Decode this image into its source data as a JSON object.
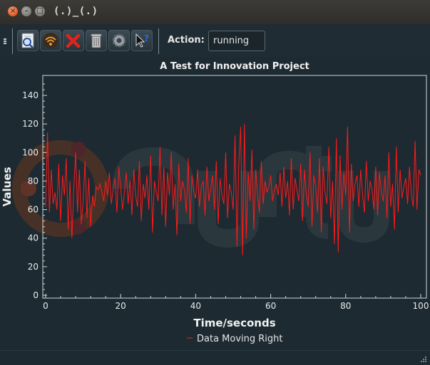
{
  "window": {
    "title": "(.)_(.)"
  },
  "toolbar": {
    "buttons": [
      {
        "icon": "zoom-document-icon"
      },
      {
        "icon": "wifi-signal-icon"
      },
      {
        "icon": "red-x-icon"
      },
      {
        "icon": "trash-can-icon"
      },
      {
        "icon": "gear-icon"
      },
      {
        "icon": "whats-this-help-icon"
      }
    ],
    "action_label": "Action:",
    "action_value": "running"
  },
  "colors": {
    "series": "#ff1a1a",
    "axis": "#cfd6da",
    "background": "#1d2a31"
  },
  "chart_data": {
    "type": "line",
    "title": "A Test for Innovation Project",
    "xlabel": "Time/seconds",
    "ylabel": "Values",
    "xlim": [
      0,
      100
    ],
    "ylim": [
      -2,
      154
    ],
    "xticks": [
      0,
      20,
      40,
      60,
      80,
      100
    ],
    "yticks": [
      0,
      20,
      40,
      60,
      80,
      100,
      120,
      140
    ],
    "grid": false,
    "legend": "bottom-center",
    "series": [
      {
        "name": "Data Moving Right",
        "x": [
          0,
          0.5,
          1,
          1.5,
          2,
          2.5,
          3,
          3.5,
          4,
          4.5,
          5,
          5.5,
          6,
          6.5,
          7,
          7.5,
          8,
          8.5,
          9,
          9.5,
          10,
          10.5,
          11,
          11.5,
          12,
          12.5,
          13,
          13.5,
          14,
          14.5,
          15,
          15.5,
          16,
          16.5,
          17,
          17.5,
          18,
          18.5,
          19,
          19.5,
          20,
          20.5,
          21,
          21.5,
          22,
          22.5,
          23,
          23.5,
          24,
          24.5,
          25,
          25.5,
          26,
          26.5,
          27,
          27.5,
          28,
          28.5,
          29,
          29.5,
          30,
          30.5,
          31,
          31.5,
          32,
          32.5,
          33,
          33.5,
          34,
          34.5,
          35,
          35.5,
          36,
          36.5,
          37,
          37.5,
          38,
          38.5,
          39,
          39.5,
          40,
          40.5,
          41,
          41.5,
          42,
          42.5,
          43,
          43.5,
          44,
          44.5,
          45,
          45.5,
          46,
          46.5,
          47,
          47.5,
          48,
          48.5,
          49,
          49.5,
          50,
          50.5,
          51,
          51.5,
          52,
          52.5,
          53,
          53.5,
          54,
          54.5,
          55,
          55.5,
          56,
          56.5,
          57,
          57.5,
          58,
          58.5,
          59,
          59.5,
          60,
          60.5,
          61,
          61.5,
          62,
          62.5,
          63,
          63.5,
          64,
          64.5,
          65,
          65.5,
          66,
          66.5,
          67,
          67.5,
          68,
          68.5,
          69,
          69.5,
          70,
          70.5,
          71,
          71.5,
          72,
          72.5,
          73,
          73.5,
          74,
          74.5,
          75,
          75.5,
          76,
          76.5,
          77,
          77.5,
          78,
          78.5,
          79,
          79.5,
          80,
          80.5,
          81,
          81.5,
          82,
          82.5,
          83,
          83.5,
          84,
          84.5,
          85,
          85.5,
          86,
          86.5,
          87,
          87.5,
          88,
          88.5,
          89,
          89.5,
          90,
          90.5,
          91,
          91.5,
          92,
          92.5,
          93,
          93.5,
          94,
          94.5,
          95,
          95.5,
          96,
          96.5,
          97,
          97.5,
          98,
          98.5,
          99,
          99.5,
          100
        ],
        "values": [
          62,
          114,
          58,
          88,
          64,
          72,
          60,
          92,
          52,
          84,
          70,
          96,
          46,
          80,
          40,
          74,
          100,
          58,
          88,
          50,
          66,
          94,
          54,
          82,
          48,
          70,
          62,
          76,
          74,
          78,
          72,
          66,
          80,
          70,
          86,
          64,
          74,
          82,
          58,
          90,
          76,
          60,
          72,
          86,
          64,
          80,
          56,
          88,
          70,
          62,
          94,
          52,
          78,
          68,
          84,
          60,
          98,
          44,
          80,
          72,
          66,
          104,
          56,
          90,
          48,
          86,
          70,
          100,
          60,
          78,
          42,
          92,
          66,
          80,
          74,
          58,
          96,
          50,
          84,
          72,
          68,
          88,
          62,
          76,
          80,
          56,
          90,
          66,
          74,
          84,
          60,
          94,
          50,
          82,
          70,
          64,
          100,
          54,
          78,
          72,
          60,
          112,
          34,
          92,
          118,
          28,
          120,
          40,
          86,
          66,
          102,
          46,
          88,
          70,
          58,
          94,
          64,
          80,
          72,
          76,
          84,
          66,
          74,
          78,
          70,
          86,
          62,
          90,
          68,
          80,
          56,
          96,
          60,
          82,
          74,
          66,
          92,
          52,
          88,
          70,
          62,
          100,
          48,
          84,
          76,
          58,
          96,
          44,
          90,
          72,
          64,
          104,
          54,
          80,
          36,
          110,
          30,
          98,
          60,
          86,
          70,
          118,
          44,
          92,
          66,
          78,
          84,
          62,
          88,
          70,
          58,
          94,
          66,
          80,
          74,
          60,
          90,
          56,
          86,
          72,
          66,
          84,
          54,
          100,
          62,
          78,
          46,
          104,
          58,
          88,
          68,
          76,
          82,
          64,
          90,
          70,
          62,
          108,
          60,
          88,
          84
        ]
      }
    ]
  }
}
